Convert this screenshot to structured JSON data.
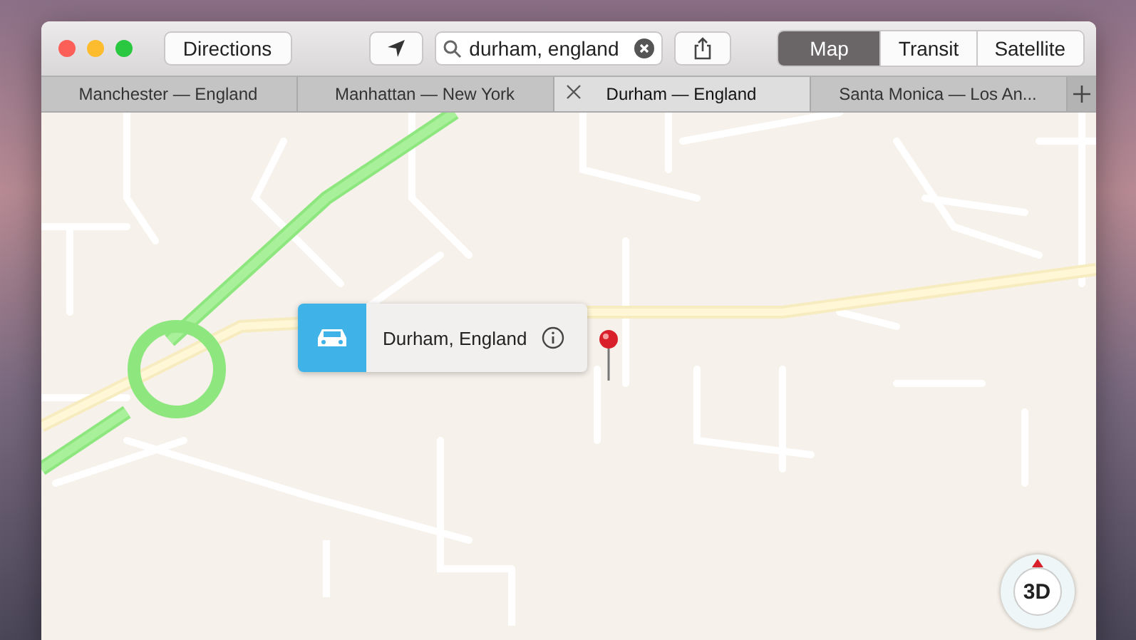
{
  "toolbar": {
    "directions_button": "Directions",
    "search": {
      "value": "durham, england"
    },
    "view_modes": [
      {
        "label": "Map",
        "selected": true
      },
      {
        "label": "Transit",
        "selected": false
      },
      {
        "label": "Satellite",
        "selected": false
      }
    ]
  },
  "tabs": [
    {
      "label": "Manchester — England",
      "selected": false
    },
    {
      "label": "Manhattan — New York",
      "selected": false
    },
    {
      "label": "Durham — England",
      "selected": true
    },
    {
      "label": "Santa Monica — Los An...",
      "selected": false
    }
  ],
  "map": {
    "callout": {
      "title": "Durham, England"
    },
    "compass_button": "3D"
  }
}
